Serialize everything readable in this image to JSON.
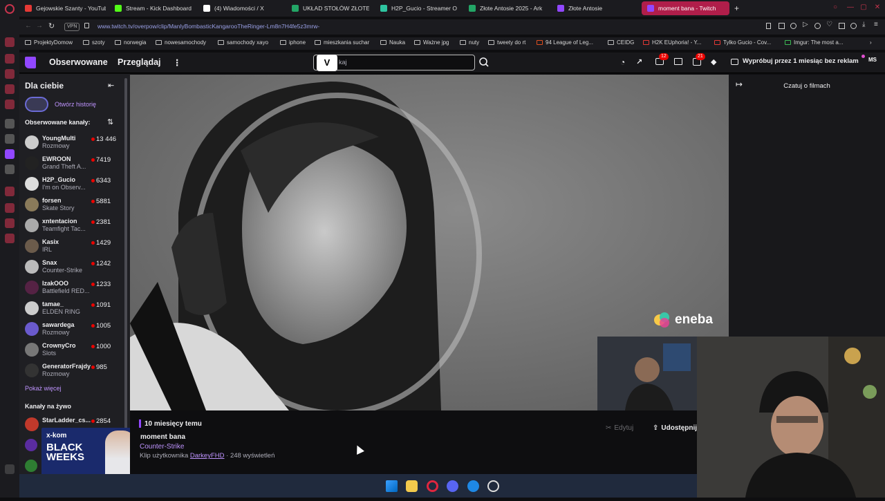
{
  "browser": {
    "tabs": [
      {
        "label": "Gejowskie Szanty - YouTube",
        "color": "#e53935"
      },
      {
        "label": "Stream - Kick Dashboard",
        "color": "#53fc18"
      },
      {
        "label": "(4) Wiadomości / X",
        "color": "#ffffff"
      },
      {
        "label": "UKŁAD STOŁÓW ZŁOTE",
        "color": "#23a566"
      },
      {
        "label": "H2P_Gucio - Streamer O",
        "color": "#2ec4a0"
      },
      {
        "label": "Złote Antosie 2025 - Ark",
        "color": "#23a566"
      },
      {
        "label": "Złote Antosie",
        "color": "#9147ff"
      },
      {
        "label": "moment bana - Twitch",
        "color": "#9147ff",
        "active": true
      }
    ],
    "new_tab": "+",
    "url": "www.twitch.tv/overpow/clip/ManlyBombasticKangarooTheRinger-Lm8n7H4fe5z3mrw-",
    "vpn_label": "VPN",
    "bookmarks": [
      "ProjektyDomow",
      "szoty",
      "norwegia",
      "nowesamochody",
      "samochody xayo",
      "iphone",
      "mieszkania suchar",
      "Nauka",
      "Ważne jpg",
      "nuty",
      "tweety do rt",
      "94 League of Leg...",
      "CEIDG",
      "H2K EUphoria! - Y...",
      "Tylko Gucio - Cov...",
      "Imgur: The most a..."
    ]
  },
  "twitch": {
    "nav": {
      "following": "Obserwowane",
      "browse": "Przeglądaj",
      "more": "⋮"
    },
    "search": {
      "placeholder": "Szukaj",
      "visible_text": "kaj"
    },
    "badges": {
      "inventory": "12",
      "notifications": "21"
    },
    "promo": "Wypróbuj przez 1 miesiąc bez reklam",
    "avatar": "MS",
    "sidebar": {
      "title": "Dla ciebie",
      "history": "Otwórz historię",
      "followed_heading": "Obserwowane kanały:",
      "channels": [
        {
          "name": "YoungMulti",
          "game": "Rozmowy",
          "viewers": "13 446",
          "color": "#ccc"
        },
        {
          "name": "EWROON",
          "game": "Grand Theft A...",
          "viewers": "7419",
          "color": "#222"
        },
        {
          "name": "H2P_Gucio",
          "game": "I'm on Observ...",
          "viewers": "6343",
          "color": "#ddd"
        },
        {
          "name": "forsen",
          "game": "Skate Story",
          "viewers": "5881",
          "color": "#8a7a5a"
        },
        {
          "name": "xntentacion",
          "game": "Teamfight Tac...",
          "viewers": "2381",
          "color": "#aaa"
        },
        {
          "name": "Kasix",
          "game": "IRL",
          "viewers": "1429",
          "color": "#6b5b4b"
        },
        {
          "name": "Snax",
          "game": "Counter-Strike",
          "viewers": "1242",
          "color": "#bbb"
        },
        {
          "name": "IzakOOO",
          "game": "Battlefield RED...",
          "viewers": "1233",
          "color": "#552244"
        },
        {
          "name": "tamae_",
          "game": "ELDEN RING",
          "viewers": "1091",
          "color": "#ccc"
        },
        {
          "name": "sawardega",
          "game": "Rozmowy",
          "viewers": "1005",
          "color": "#6a5acd"
        },
        {
          "name": "CrownyCro",
          "game": "Slots",
          "viewers": "1000",
          "color": "#777"
        },
        {
          "name": "GeneratorFrajdy",
          "game": "Rozmowy",
          "viewers": "985",
          "color": "#333"
        }
      ],
      "show_more": "Pokaż więcej",
      "live_heading": "Kanały na żywo",
      "live_channel": {
        "name": "StarLadder_cs...",
        "viewers": "2854"
      }
    },
    "ad": {
      "brand": "x-kom",
      "headline": "BLACK WEEKS"
    },
    "overlay_brand": "eneba",
    "chat_title": "Czatuj o filmach",
    "clip": {
      "ago": "10 miesięcy temu",
      "title": "moment bana",
      "game": "Counter-Strike",
      "by_prefix": "Klip użytkownika",
      "by_user": "DarkeyFHD",
      "views": "· 248 wyświetleń",
      "edit": "Edytuj",
      "share": "Udostępnij"
    }
  },
  "taskbar": {
    "icons": [
      "windows-start-icon",
      "file-explorer-icon",
      "opera-icon",
      "discord-icon",
      "messenger-icon",
      "app-icon"
    ]
  }
}
